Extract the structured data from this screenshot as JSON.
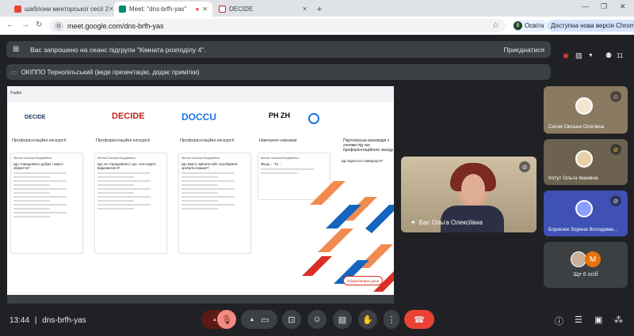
{
  "browser": {
    "tabs": [
      {
        "label": "шаблони менторської сесії 2"
      },
      {
        "label": "Meet: \"dns-brfh-yas\""
      },
      {
        "label": "DECIDE"
      }
    ],
    "new_tab": "+",
    "url": "meet.google.com/dns-brfh-yas",
    "profile_initial": "6",
    "profile_label": "Освіта",
    "update_label": "Доступна нова версія Chrome"
  },
  "meet": {
    "breakout_banner": "Вас запрошено на сеанс підгрупи \"Кімната розподілу 4\".",
    "join_label": "Приєднатися",
    "presenter_banner": "ОКІППО Тернопільський (веде презентацію, додає примітки)",
    "participant_count": "11",
    "meeting_code": "dns-brfh-yas",
    "clock": "13:44",
    "others_label": "Ще 6 осіб",
    "others_initial": "M"
  },
  "slide": {
    "board_title": "Padlet",
    "logos": [
      "DECIDE",
      "DECIDE",
      "DOCCU",
      "PH ZH"
    ],
    "columns": [
      {
        "title": "Профорієнтаційні екскурсії",
        "question": "Що спрацювало добре і варто зберегти?",
        "author": "Мечик Оксана Богданівна"
      },
      {
        "title": "Профорієнтаційні екскурсії",
        "question": "Що не спрацювало і що, чого варто відмовитися?",
        "author": "Мечик Оксана Богданівна"
      },
      {
        "title": "Профорієнтаційні екскурсії",
        "question": "Що варто змінити або спробувати зробити інакше?",
        "author": "Мечик Оксана Богданівна"
      },
      {
        "title": "Навчання навзаєм",
        "question": "Якщо… То…",
        "author": "Мечик Оксана Богданівна"
      }
    ],
    "side_panel": "Партнерська взаємодія з учнями під час профорієнтаційного заходу",
    "side_question": "Що вдається наведнуся?",
    "vision_label": "Обуфлеварха дена"
  },
  "tiles": [
    {
      "name": "Бас Ольга Олексіївна"
    },
    {
      "name": "Сесик Оксана Олегівна"
    },
    {
      "name": "Котут Ольга Іванівна"
    },
    {
      "name": "Борисюк Зоряна Володими..."
    }
  ],
  "colors": {
    "accent_red": "#ea4335",
    "meet_bg": "#202124",
    "panel": "#3c4043"
  },
  "icons": [
    "gmail-icon",
    "meet-icon",
    "decide-icon",
    "refresh-icon",
    "star-icon",
    "mic-off-icon",
    "camera-icon",
    "present-icon",
    "emoji-icon",
    "captions-icon",
    "hand-icon",
    "more-icon",
    "hangup-icon",
    "info-icon",
    "chat-icon",
    "people-icon",
    "activities-icon"
  ]
}
